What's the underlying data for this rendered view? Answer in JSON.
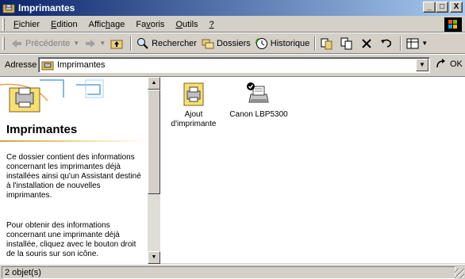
{
  "window": {
    "title": "Imprimantes",
    "controls": {
      "minimize": "_",
      "maximize": "□",
      "close": "X"
    }
  },
  "menubar": {
    "items": [
      {
        "label": "Fichier",
        "accel": "F"
      },
      {
        "label": "Edition",
        "accel": "E"
      },
      {
        "label": "Affichage",
        "accel": "h"
      },
      {
        "label": "Favoris",
        "accel": "v"
      },
      {
        "label": "Outils",
        "accel": "O"
      },
      {
        "label": "?",
        "accel": "?"
      }
    ]
  },
  "toolbar": {
    "back_label": "Précédente",
    "search_label": "Rechercher",
    "folders_label": "Dossiers",
    "history_label": "Historique"
  },
  "address": {
    "label": "Adresse",
    "value": "Imprimantes",
    "go_label": "OK"
  },
  "left_panel": {
    "title": "Imprimantes",
    "paragraph1": "Ce dossier contient des informations concernant les imprimantes déjà installées ainsi qu'un Assistant destiné à l'installation de nouvelles imprimantes.",
    "paragraph2": "Pour obtenir des informations concernant une imprimante déjà installée, cliquez avec le bouton droit de la souris sur son icône."
  },
  "items": [
    {
      "label": "Ajout d'imprimante",
      "icon": "add-printer-icon"
    },
    {
      "label": "Canon LBP5300",
      "icon": "default-printer-icon"
    }
  ],
  "status": {
    "text": "2 objet(s)"
  },
  "colors": {
    "titlebar_start": "#0a246a",
    "titlebar_end": "#a6caf0",
    "face": "#d4d0c8"
  }
}
